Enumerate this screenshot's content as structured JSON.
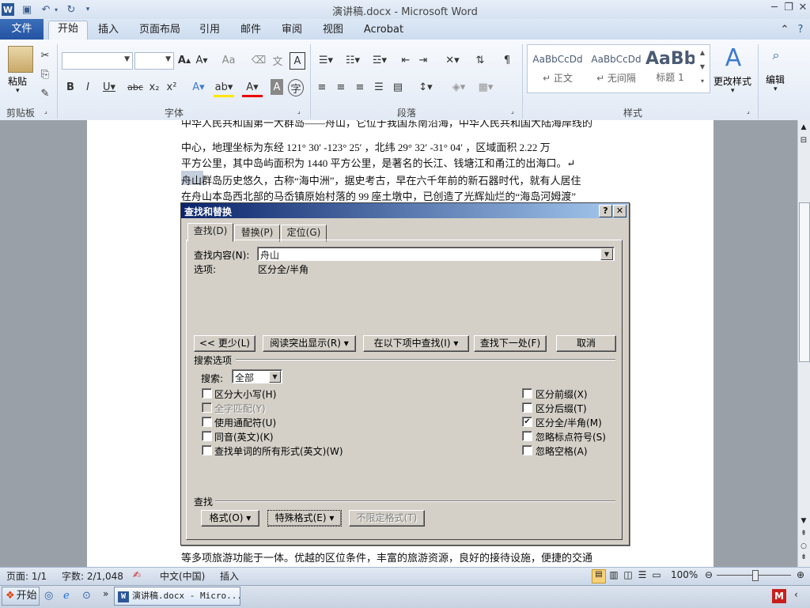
{
  "window": {
    "title": "演讲稿.docx - Microsoft Word"
  },
  "ribbon": {
    "file_tab": "文件",
    "tabs": [
      "开始",
      "插入",
      "页面布局",
      "引用",
      "邮件",
      "审阅",
      "视图",
      "Acrobat"
    ],
    "groups": [
      "剪贴板",
      "字体",
      "段落",
      "样式"
    ],
    "paste_label": "粘贴",
    "edit_label": "编辑",
    "change_styles_label": "更改样式",
    "styles": [
      {
        "preview": "AaBbCcDd",
        "name": "↵ 正文"
      },
      {
        "preview": "AaBbCcDd",
        "name": "↵ 无间隔"
      },
      {
        "preview": "AaBb",
        "name": "标题 1"
      }
    ]
  },
  "document": {
    "lines": [
      "中华人民共和国第一大群岛——舟山，它位于我国东南沿海，中华人民共和国大陆海岸线的",
      "中心，地理坐标为东经 121° 30′ -123° 25′ ，北纬 29° 32′ -31° 04′ ，区域面积 2.22 万",
      "平方公里，其中岛屿面积为 1440 平方公里，是著名的长江、钱塘江和甬江的出海口。↵",
      "舟山群岛历史悠久，古称“海中洲”，据史考古，早在六千年前的新石器时代，就有人居住",
      "在舟山本岛西北部的马岙镇原始村落的 99 座土墩中，已创造了光辉灿烂的“海岛河姆渡”",
      "等多项旅游功能于一体。优越的区位条件，丰富的旅游资源，良好的接待设施，便捷的交通"
    ]
  },
  "dialog": {
    "title": "查找和替换",
    "help": "?",
    "close": "✕",
    "tabs": [
      "查找(D)",
      "替换(P)",
      "定位(G)"
    ],
    "find_label": "查找内容(N):",
    "find_value": "舟山",
    "options_label": "选项:",
    "options_value": "区分全/半角",
    "buttons": {
      "less": "<< 更少(L)",
      "reading_highlight": "阅读突出显示(R) ▾",
      "find_in": "在以下项中查找(I) ▾",
      "find_next": "查找下一处(F)",
      "cancel": "取消"
    },
    "search_options_label": "搜索选项",
    "search_label": "搜索:",
    "search_value": "全部",
    "left_checks": [
      {
        "label": "区分大小写(H)",
        "checked": false,
        "disabled": false
      },
      {
        "label": "全字匹配(Y)",
        "checked": false,
        "disabled": true
      },
      {
        "label": "使用通配符(U)",
        "checked": false,
        "disabled": false
      },
      {
        "label": "同音(英文)(K)",
        "checked": false,
        "disabled": false
      },
      {
        "label": "查找单词的所有形式(英文)(W)",
        "checked": false,
        "disabled": false
      }
    ],
    "right_checks": [
      {
        "label": "区分前缀(X)",
        "checked": false
      },
      {
        "label": "区分后缀(T)",
        "checked": false
      },
      {
        "label": "区分全/半角(M)",
        "checked": true
      },
      {
        "label": "忽略标点符号(S)",
        "checked": false
      },
      {
        "label": "忽略空格(A)",
        "checked": false
      }
    ],
    "find_section_label": "查找",
    "format_btn": "格式(O) ▾",
    "special_btn": "特殊格式(E) ▾",
    "no_format_btn": "不限定格式(T)"
  },
  "status": {
    "page": "页面: 1/1",
    "words": "字数: 2/1,048",
    "language": "中文(中国)",
    "mode": "插入",
    "zoom": "100%"
  },
  "taskbar": {
    "start": "开始",
    "task": "演讲稿.docx - Micro..."
  },
  "colors": {
    "accent": "#2453a2",
    "dialog_title": "#0a246a"
  }
}
